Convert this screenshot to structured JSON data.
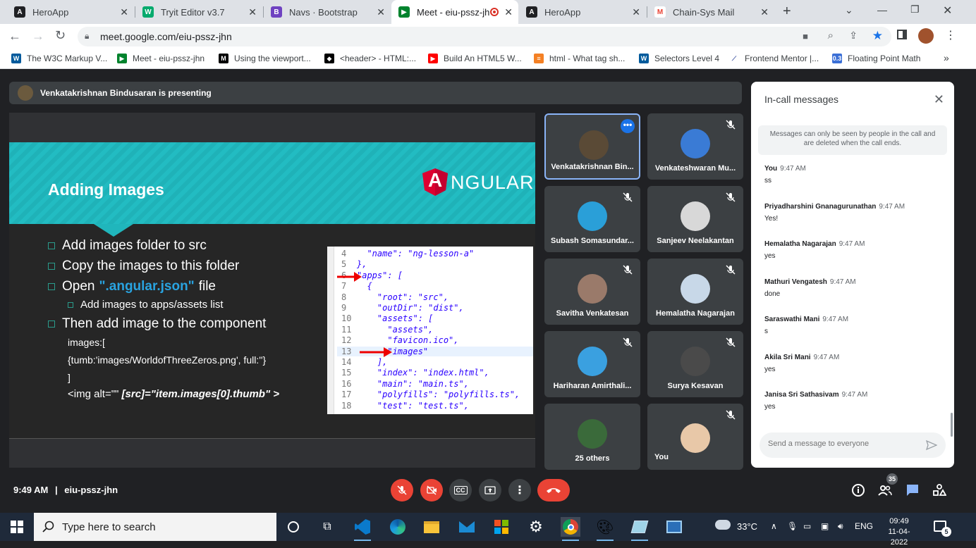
{
  "browser": {
    "tabs": [
      {
        "label": "HeroApp",
        "icon": "angular-favicon"
      },
      {
        "label": "Tryit Editor v3.7",
        "icon": "w3schools-favicon"
      },
      {
        "label": "Navs · Bootstrap",
        "icon": "bootstrap-favicon"
      },
      {
        "label": "Meet - eiu-pssz-jh",
        "icon": "meet-favicon",
        "active": true
      },
      {
        "label": "HeroApp",
        "icon": "angular-favicon"
      },
      {
        "label": "Chain-Sys Mail",
        "icon": "gmail-favicon"
      }
    ],
    "url": "meet.google.com/eiu-pssz-jhn",
    "bookmarks": [
      "The W3C Markup V...",
      "Meet - eiu-pssz-jhn",
      "Using the viewport...",
      "<header> - HTML:...",
      "Build An HTML5 W...",
      "html - What tag sh...",
      "Selectors Level 4",
      "Frontend Mentor |...",
      "Floating Point Math"
    ],
    "more_bookmarks": "»"
  },
  "meet": {
    "presenting_text": "Venkatakrishnan Bindusaran is presenting",
    "slide": {
      "title": "Adding Images",
      "logo_text": "NGULAR",
      "logo_letter": "A",
      "bullets": [
        "Add images folder to src",
        "Copy the images to this folder"
      ],
      "open_prefix": "Open",
      "open_highlight": "\".angular.json\"",
      "open_suffix": "file",
      "sub_bullet": "Add images to apps/assets list",
      "then_bullet": "Then add image to the component",
      "code_lines": [
        "images:[",
        " {tumb:'images/WorldofThreeZeros.png', full:''}",
        "]",
        "<img alt=\"\"",
        "[src]=\"item.images[0].thumb\" >"
      ],
      "editor_lines": [
        {
          "n": "4",
          "text": "  \"name\": \"ng-lesson-a\""
        },
        {
          "n": "5",
          "text": "},"
        },
        {
          "n": "6",
          "text": "\"apps\": ["
        },
        {
          "n": "7",
          "text": "  {"
        },
        {
          "n": "8",
          "text": "    \"root\": \"src\","
        },
        {
          "n": "9",
          "text": "    \"outDir\": \"dist\","
        },
        {
          "n": "10",
          "text": "    \"assets\": ["
        },
        {
          "n": "11",
          "text": "      \"assets\","
        },
        {
          "n": "12",
          "text": "      \"favicon.ico\","
        },
        {
          "n": "13",
          "text": "      \"images\""
        },
        {
          "n": "14",
          "text": "    ],"
        },
        {
          "n": "15",
          "text": "    \"index\": \"index.html\","
        },
        {
          "n": "16",
          "text": "    \"main\": \"main.ts\","
        },
        {
          "n": "17",
          "text": "    \"polyfills\": \"polyfills.ts\","
        },
        {
          "n": "18",
          "text": "    \"test\": \"test.ts\","
        }
      ]
    },
    "participants": [
      {
        "name": "Venkatakrishnan Bin...",
        "color": "#5a4a36"
      },
      {
        "name": "Venkateshwaran Mu...",
        "color": "#3a7bd5"
      },
      {
        "name": "Subash Somasundar...",
        "color": "#2a9fd8"
      },
      {
        "name": "Sanjeev Neelakantan",
        "color": "#d8d8d8"
      },
      {
        "name": "Savitha Venkatesan",
        "color": "#9a7a6a"
      },
      {
        "name": "Hemalatha Nagarajan",
        "color": "#c8d8e8"
      },
      {
        "name": "Hariharan Amirthali...",
        "color": "#3aa0e0"
      },
      {
        "name": "Surya Kesavan",
        "color": "#4a4a4a"
      },
      {
        "name": "25 others",
        "color": "#3a6a3a"
      },
      {
        "name": "You",
        "color": "#e8c8a8"
      }
    ],
    "chat": {
      "title": "In-call messages",
      "note": "Messages can only be seen by people in the call and are deleted when the call ends.",
      "messages": [
        {
          "who": "You",
          "time": "9:47 AM",
          "text": "ss"
        },
        {
          "who": "Priyadharshini Gnanagurunathan",
          "time": "9:47 AM",
          "text": "Yes!"
        },
        {
          "who": "Hemalatha Nagarajan",
          "time": "9:47 AM",
          "text": "yes"
        },
        {
          "who": "Mathuri Vengatesh",
          "time": "9:47 AM",
          "text": "done"
        },
        {
          "who": "Saraswathi Mani",
          "time": "9:47 AM",
          "text": "s"
        },
        {
          "who": "Akila Sri Mani",
          "time": "9:47 AM",
          "text": "yes"
        },
        {
          "who": "Janisa Sri Sathasivam",
          "time": "9:47 AM",
          "text": "yes"
        }
      ],
      "input_placeholder": "Send a message to everyone"
    },
    "bottom": {
      "time": "9:49 AM",
      "separator": "|",
      "meeting_code": "eiu-pssz-jhn",
      "people_count": "35"
    }
  },
  "taskbar": {
    "search_placeholder": "Type here to search",
    "weather": "33°C",
    "language": "ENG",
    "time": "09:49",
    "date": "11-04-2022",
    "notification_count": "5"
  }
}
